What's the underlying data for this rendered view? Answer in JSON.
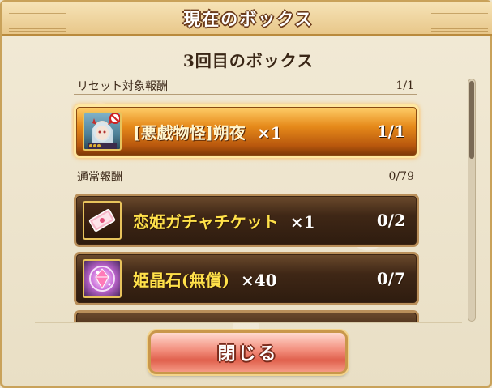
{
  "window": {
    "title": "現在のボックス"
  },
  "box_heading": "3回目のボックス",
  "reset_section": {
    "label": "リセット対象報酬",
    "count": "1/1",
    "items": [
      {
        "name": "[悪戯物怪]朔夜",
        "qty": "×1",
        "count": "1/1",
        "icon": "character-portrait-icon"
      }
    ]
  },
  "normal_section": {
    "label": "通常報酬",
    "count": "0/79",
    "items": [
      {
        "name": "恋姫ガチャチケット",
        "qty": "×1",
        "count": "0/2",
        "icon": "gacha-ticket-icon"
      },
      {
        "name": "姫晶石(無償)",
        "qty": "×40",
        "count": "0/7",
        "icon": "crystal-gem-icon"
      }
    ]
  },
  "close_button": {
    "label": "閉じる"
  },
  "colors": {
    "highlight": "#e68a1a",
    "card_dark": "#3f2716",
    "gold_text": "#ffe14a",
    "close_button": "#e0604d"
  }
}
